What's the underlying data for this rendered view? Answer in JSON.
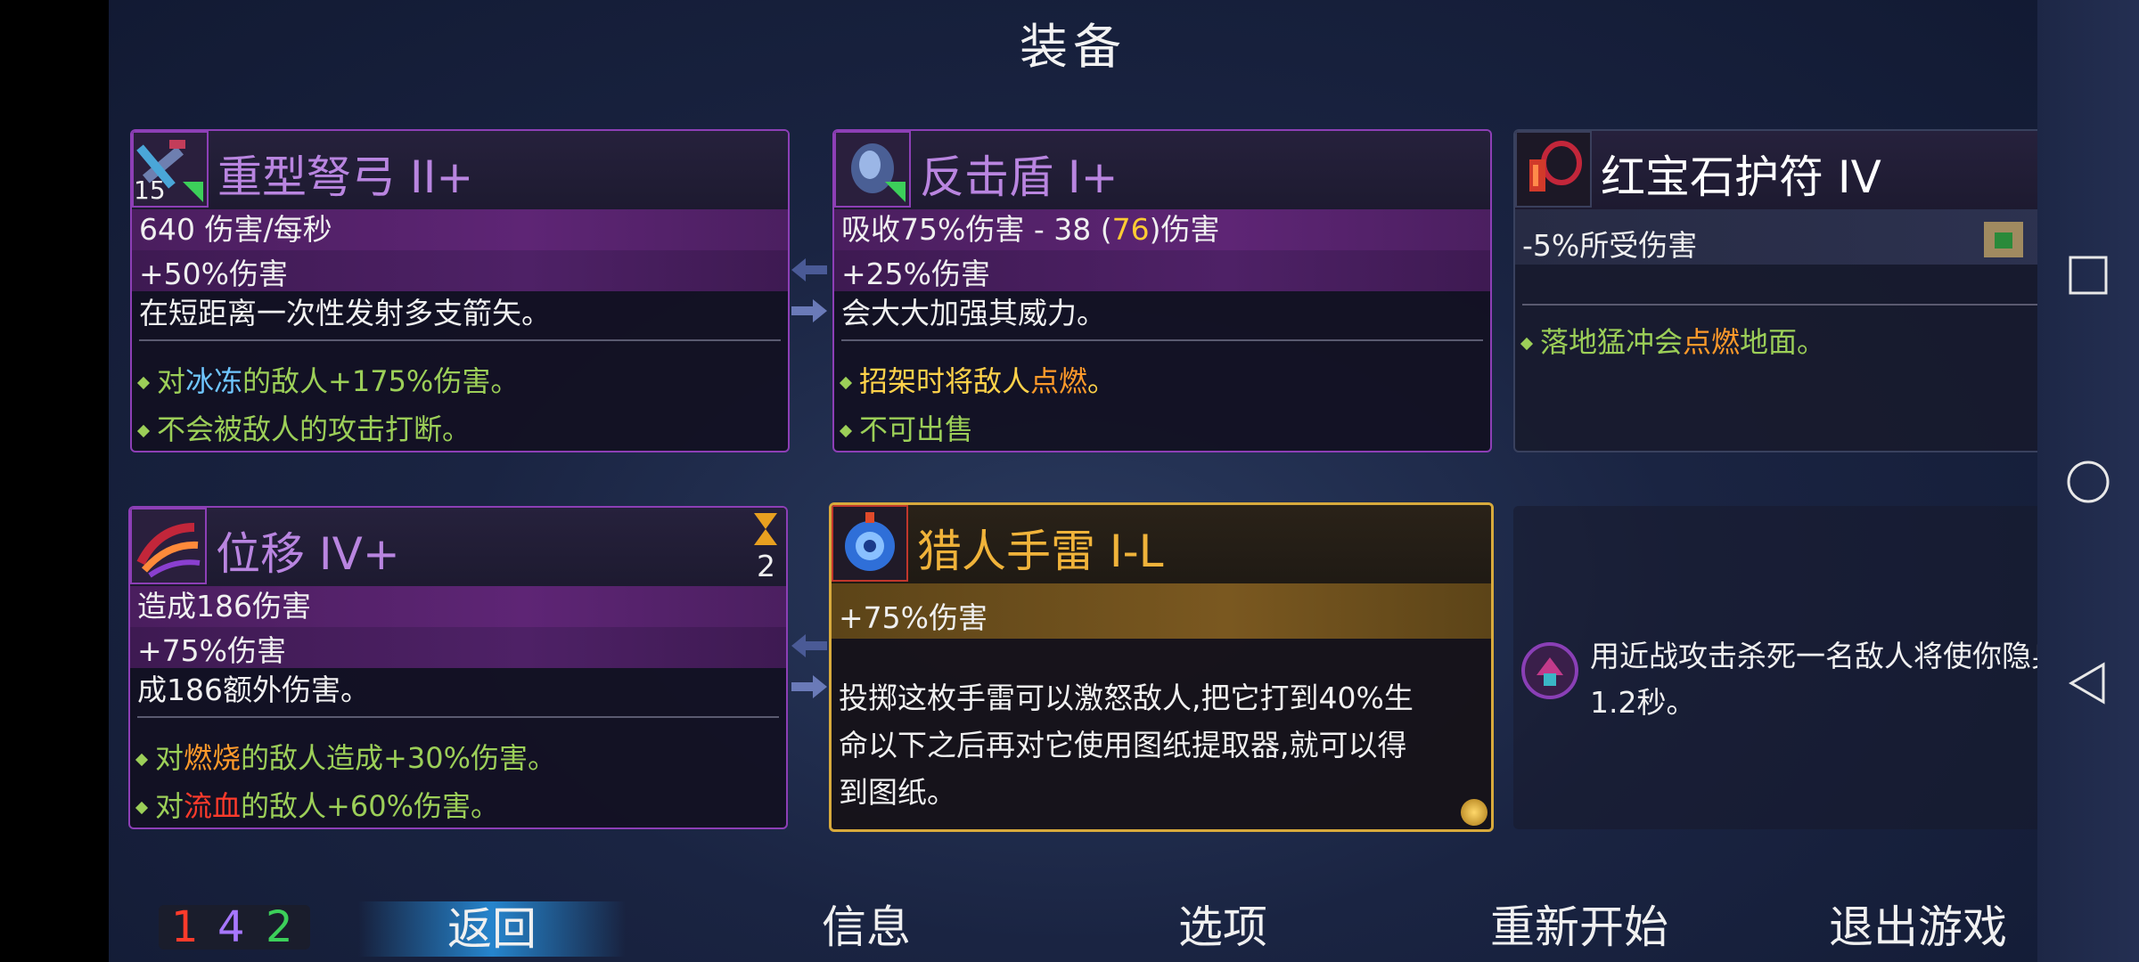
{
  "title": "装备",
  "cards": {
    "crossbow": {
      "name": "重型弩弓 II+",
      "badge": "15",
      "stat1": "640 伤害/每秒",
      "stat2": "+50%伤害",
      "desc": "在短距离一次性发射多支箭矢。",
      "b1_pre": "对",
      "b1_hl": "冰冻",
      "b1_post": "的敌人+175%伤害。",
      "b2": "不会被敌人的攻击打断。"
    },
    "shield": {
      "name": "反击盾 I+",
      "stat1_pre": "吸收75%伤害 - 38 (",
      "stat1_hl": "76",
      "stat1_post": ")伤害",
      "stat2": "+25%伤害",
      "desc": "会大大加强其威力。",
      "b1_pre": "招架时将敌人",
      "b1_hl": "点燃",
      "b1_post": "。",
      "b2": "不可出售"
    },
    "amulet": {
      "name": "红宝石护符 IV",
      "stat1": "-5%所受伤害",
      "scroll_count": "1",
      "b1_pre": "落地猛冲会",
      "b1_hl": "点燃",
      "b1_post": "地面。"
    },
    "shift": {
      "name": "位移 IV+",
      "cooldown": "2",
      "stat1": "造成186伤害",
      "stat2": "+75%伤害",
      "desc": "成186额外伤害。",
      "b1_pre": "对",
      "b1_hl": "燃烧",
      "b1_post": "的敌人造成+30%伤害。",
      "b2_pre": "对",
      "b2_hl": "流血",
      "b2_post": "的敌人+60%伤害。"
    },
    "grenade": {
      "name": "猎人手雷 I-L",
      "stat1": "+75%伤害",
      "desc1": "投掷这枚手雷可以激怒敌人,把它打到40%生",
      "desc2": "命以下之后再对它使用图纸提取器,就可以得",
      "desc3": "到图纸。"
    },
    "mutation": {
      "line1": "用近战攻击杀死一名敌人将使你隐身",
      "line2": "1.2秒。"
    }
  },
  "counters": {
    "red": "1",
    "purple": "4",
    "green": "2"
  },
  "menu": {
    "back": "返回",
    "info": "信息",
    "options": "选项",
    "restart": "重新开始",
    "quit": "退出游戏"
  },
  "colors": {
    "brutality": "#ff3b2b",
    "tactics": "#a777ff",
    "survival": "#3ccf5a",
    "legendary_gold": "#d8aa3c",
    "card_border": "#8d3fb6"
  }
}
